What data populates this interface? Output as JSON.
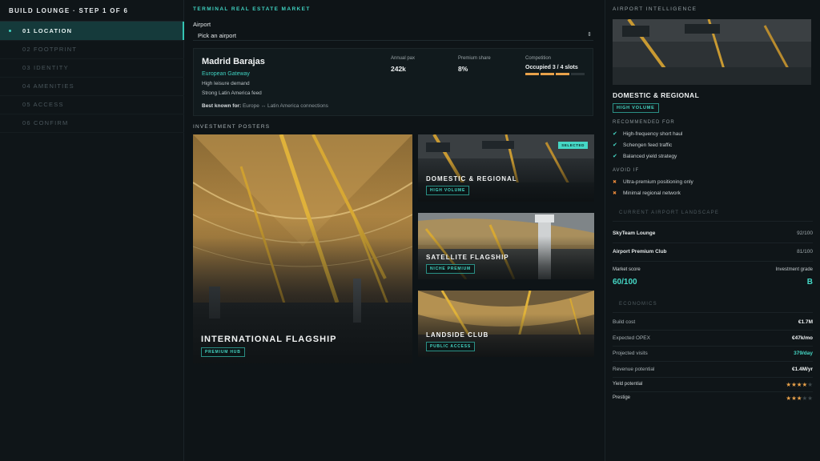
{
  "sidebar": {
    "title": "BUILD LOUNGE · STEP 1 OF 6",
    "steps": [
      {
        "label": "01 LOCATION"
      },
      {
        "label": "02 FOOTPRINT"
      },
      {
        "label": "03 IDENTITY"
      },
      {
        "label": "04 AMENITIES"
      },
      {
        "label": "05 ACCESS"
      },
      {
        "label": "06 CONFIRM"
      }
    ]
  },
  "main": {
    "section": "TERMINAL REAL ESTATE MARKET",
    "airport_label": "Airport",
    "airport_select": "Pick an airport",
    "airport": {
      "name": "Madrid Barajas",
      "subtitle": "European Gateway",
      "line1": "High leisure demand",
      "line2": "Strong Latin America feed",
      "best_label": "Best known for:",
      "best_value": "Europe ↔ Latin America connections",
      "stats": {
        "pax_label": "Annual pax",
        "pax_value": "242k",
        "premium_label": "Premium share",
        "premium_value": "8%",
        "competition_label": "Competition",
        "competition_value": "Occupied 3 / 4 slots",
        "competition_occupied": 3,
        "competition_total": 4
      }
    },
    "posters_label": "INVESTMENT POSTERS",
    "posters": [
      {
        "title": "INTERNATIONAL FLAGSHIP",
        "tag": "PREMIUM HUB"
      },
      {
        "title": "DOMESTIC & REGIONAL",
        "tag": "HIGH VOLUME",
        "badge": "SELECTED"
      },
      {
        "title": "SATELLITE FLAGSHIP",
        "tag": "NICHE PREMIUM"
      },
      {
        "title": "LANDSIDE CLUB",
        "tag": "PUBLIC ACCESS"
      }
    ]
  },
  "intel": {
    "header": "AIRPORT INTELLIGENCE",
    "title": "DOMESTIC & REGIONAL",
    "tag": "HIGH VOLUME",
    "recommended_head": "RECOMMENDED FOR",
    "recommended": [
      "High-frequency short haul",
      "Schengen feed traffic",
      "Balanced yield strategy"
    ],
    "avoid_head": "AVOID IF",
    "avoid": [
      "Ultra-premium positioning only",
      "Minimal regional network"
    ],
    "landscape_head": "CURRENT AIRPORT LANDSCAPE",
    "landscape": [
      {
        "name": "SkyTeam Lounge",
        "score": "92/100"
      },
      {
        "name": "Airport Premium Club",
        "score": "81/100"
      }
    ],
    "market_score_label": "Market score",
    "market_score": "60/100",
    "grade_label": "Investment grade",
    "grade": "B",
    "economics_head": "ECONOMICS",
    "economics": [
      {
        "label": "Build cost",
        "value": "€1.7M"
      },
      {
        "label": "Expected OPEX",
        "value": "€47k/mo"
      },
      {
        "label": "Projected visits",
        "value": "379/day"
      },
      {
        "label": "Revenue potential",
        "value": "€1.4M/yr"
      }
    ],
    "yield_label": "Yield potential",
    "yield_stars": 4,
    "prestige_label": "Prestige",
    "prestige_stars": 3,
    "stars_max": 5,
    "colors": {
      "accent": "#41d6c3",
      "star": "#e8a14a"
    }
  }
}
